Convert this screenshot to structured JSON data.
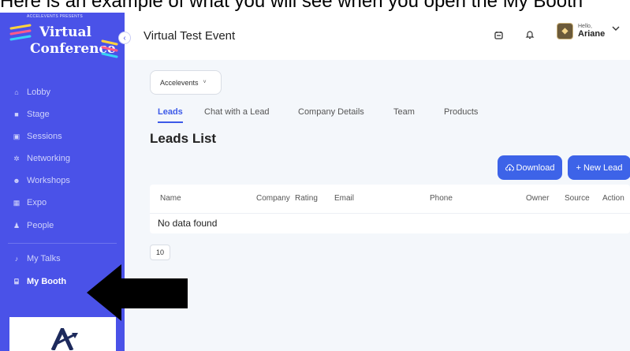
{
  "caption": "Here is an example of what you will see when you open the My Booth",
  "sidebar": {
    "brand_pre": "ACCELEVENTS PRESENTS",
    "brand_line1": "Virtual",
    "brand_line2": "Conference",
    "collapse_icon": "chevron-left-icon",
    "items": [
      {
        "label": "Lobby",
        "icon": "home-icon",
        "glyph": "⌂"
      },
      {
        "label": "Stage",
        "icon": "video-icon",
        "glyph": "■"
      },
      {
        "label": "Sessions",
        "icon": "calendar-icon",
        "glyph": "▣"
      },
      {
        "label": "Networking",
        "icon": "network-icon",
        "glyph": "✲"
      },
      {
        "label": "Workshops",
        "icon": "people-icon",
        "glyph": "☻"
      },
      {
        "label": "Expo",
        "icon": "grid-icon",
        "glyph": "▦"
      },
      {
        "label": "People",
        "icon": "person-icon",
        "glyph": "♟"
      },
      {
        "label": "My Talks",
        "icon": "mic-icon",
        "glyph": "♪"
      },
      {
        "label": "My Booth",
        "icon": "booth-icon",
        "glyph": "⌸"
      }
    ],
    "active_item": "My Booth",
    "brand_color": "#4a52e8"
  },
  "header": {
    "event_title": "Virtual Test Event",
    "calendar_icon": "calendar-icon",
    "bell_icon": "bell-icon",
    "greeting": "Hello,",
    "user_name": "Ariane",
    "chevron_icon": "chevron-down-icon"
  },
  "company_select": {
    "value": "Accelevents",
    "chevron": "˅"
  },
  "tabs": [
    {
      "label": "Leads",
      "active": true
    },
    {
      "label": "Chat with a Lead",
      "active": false
    },
    {
      "label": "Company Details",
      "active": false
    },
    {
      "label": "Team",
      "active": false
    },
    {
      "label": "Products",
      "active": false
    }
  ],
  "leads_list": {
    "heading": "Leads List",
    "download_label": "Download",
    "new_lead_label": "+ New Lead",
    "columns": [
      "Name",
      "Company",
      "Rating",
      "Email",
      "Phone",
      "Owner",
      "Source",
      "Action"
    ],
    "empty_text": "No data found",
    "page_size": "10"
  },
  "accent_color": "#3d63e8"
}
